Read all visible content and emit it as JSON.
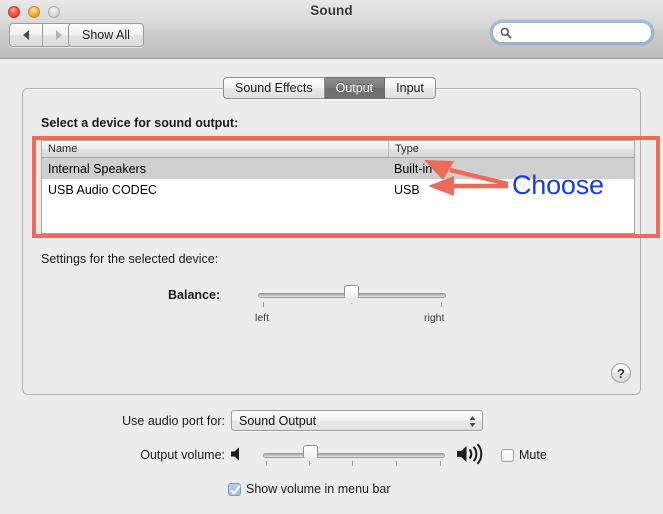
{
  "window": {
    "title": "Sound",
    "traffic_lights": {
      "close": "close-button",
      "minimize": "minimize-button",
      "zoom": "zoom-button"
    },
    "toolbar": {
      "back_label": "◀",
      "forward_label": "▶",
      "show_all_label": "Show All",
      "search_placeholder": "",
      "search_value": ""
    }
  },
  "tabs": [
    {
      "label": "Sound Effects",
      "selected": false
    },
    {
      "label": "Output",
      "selected": true
    },
    {
      "label": "Input",
      "selected": false
    }
  ],
  "output_pane": {
    "select_device_label": "Select a device for sound output:",
    "table": {
      "columns": [
        "Name",
        "Type"
      ],
      "rows": [
        {
          "name": "Internal Speakers",
          "type": "Built-in",
          "selected": true
        },
        {
          "name": "USB Audio CODEC",
          "type": "USB",
          "selected": false
        }
      ]
    },
    "settings_label": "Settings for the selected device:",
    "balance": {
      "label": "Balance:",
      "value_percent": 46,
      "min_label": "left",
      "max_label": "right"
    },
    "help_label": "?"
  },
  "annotation": {
    "text": "Choose",
    "text_color": "#1a3fd4",
    "arrow_color": "#ef6a5a",
    "box_color": "#ef6a5a"
  },
  "bottom": {
    "audio_port_label": "Use audio port for:",
    "audio_port_value": "Sound Output",
    "output_volume_label": "Output volume:",
    "output_volume_percent": 28,
    "mute_label": "Mute",
    "mute_checked": false,
    "show_volume_label": "Show volume in menu bar",
    "show_volume_checked": true
  }
}
